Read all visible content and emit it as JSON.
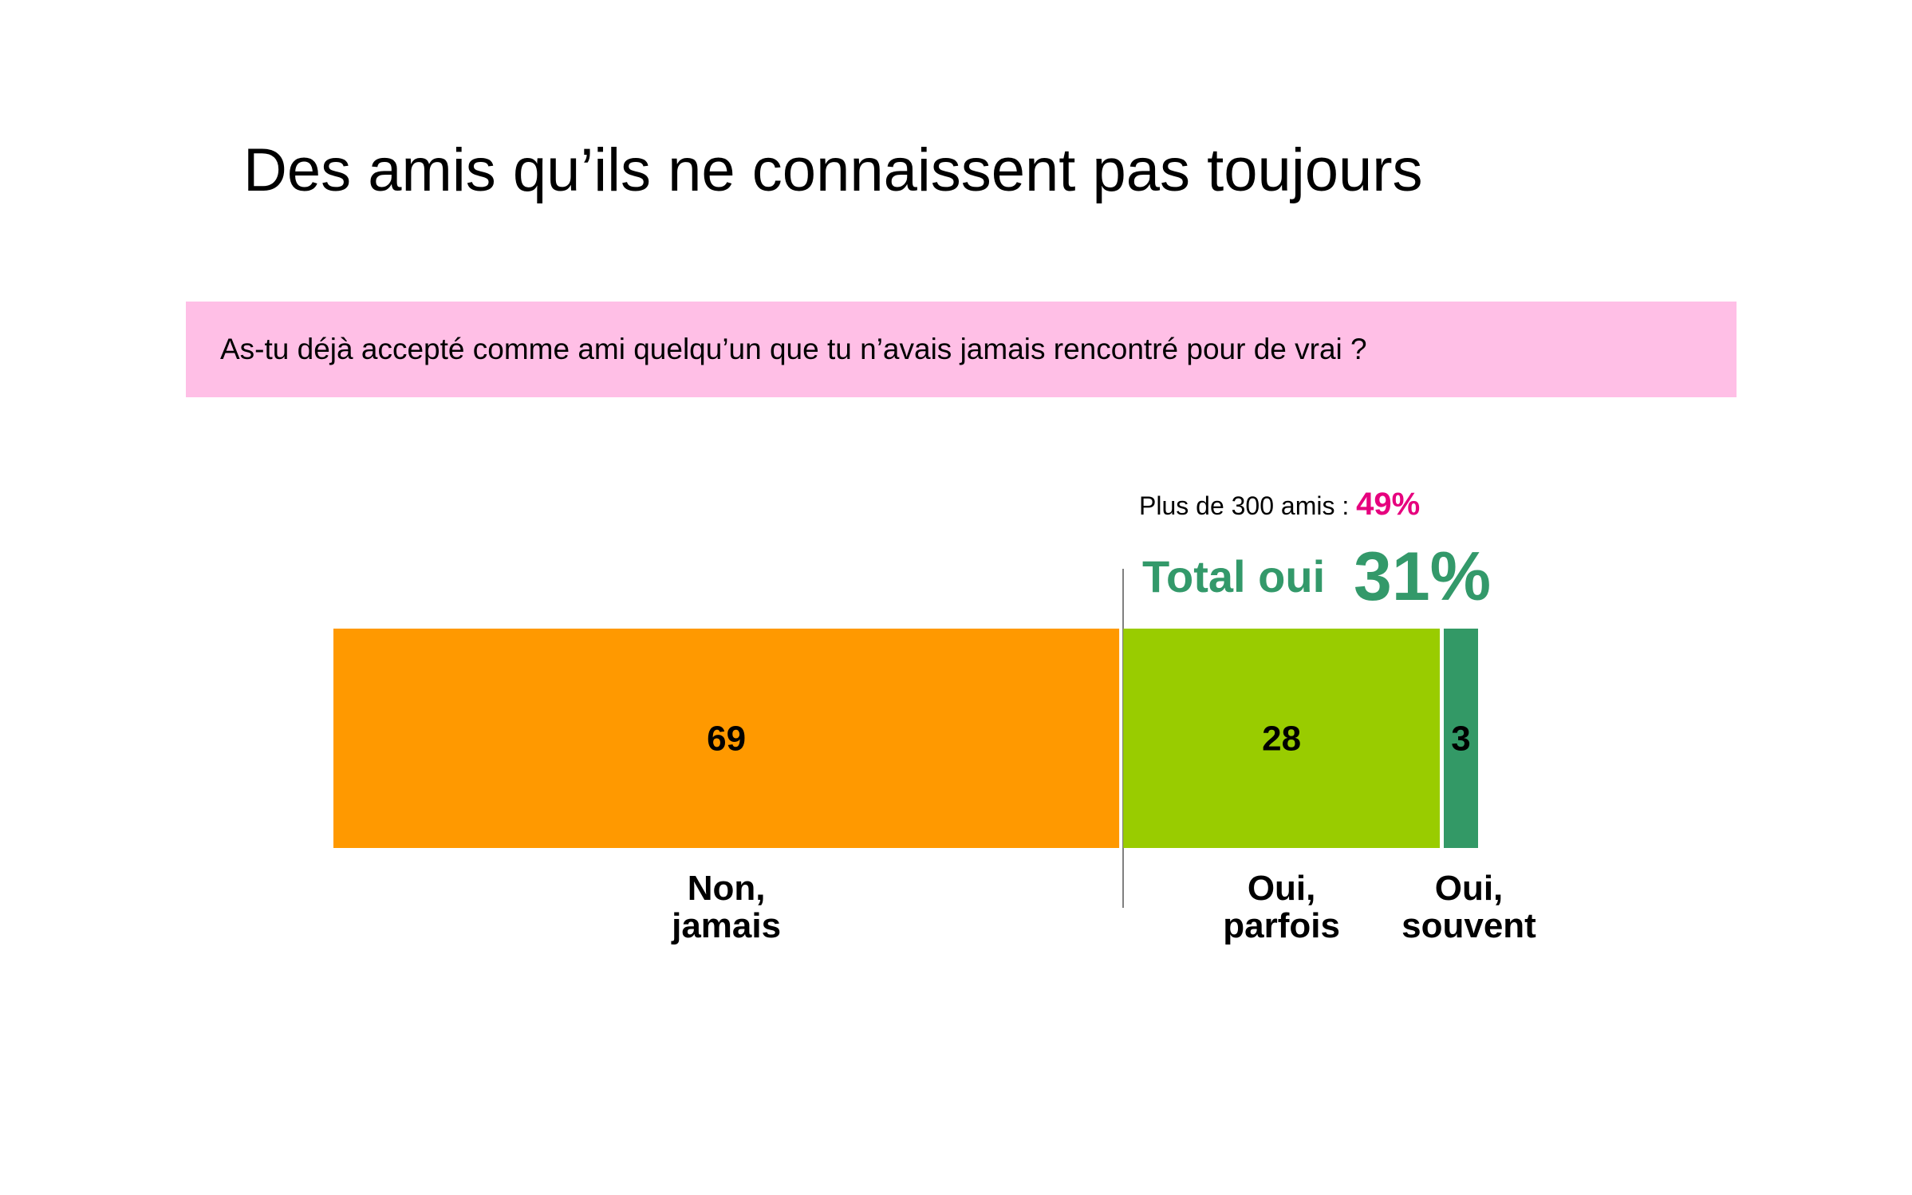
{
  "title": "Des amis qu’ils ne connaissent pas toujours",
  "question": "As-tu déjà accepté comme ami quelqu’un que tu n’avais jamais rencontré pour de vrai ?",
  "colors": {
    "question_bg": "#FFBFE6",
    "accent_pink": "#E6007E",
    "accent_green": "#33996A"
  },
  "chart_data": {
    "type": "bar",
    "orientation": "horizontal-stacked",
    "categories": [
      "Non,\njamais",
      "Oui,\nparfois",
      "Oui,\nsouvent"
    ],
    "values": [
      69,
      28,
      3
    ],
    "colors": [
      "#FF9900",
      "#99CC00",
      "#339966"
    ],
    "total": 100,
    "annotations": {
      "subgroup_label": "Plus de 300 amis : ",
      "subgroup_value": "49%",
      "total_label": "Total oui",
      "total_value": "31%"
    }
  }
}
